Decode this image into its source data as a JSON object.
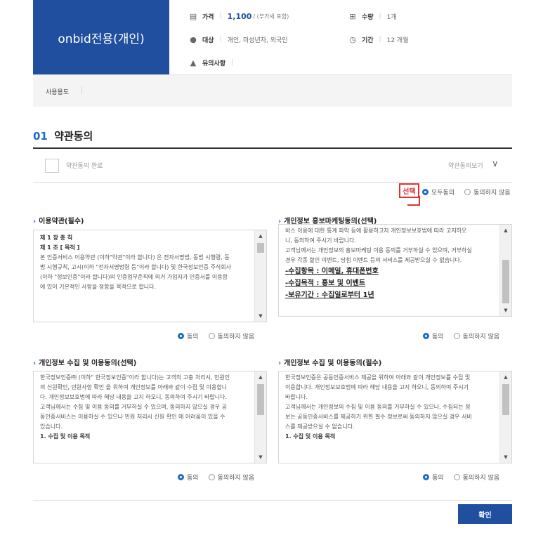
{
  "product": {
    "name": "onbid전용(개인)",
    "price_label": "가격",
    "price_value": "1,100",
    "price_unit": "/ (부가세 포함)",
    "quantity_label": "수량",
    "quantity_value": "1개",
    "target_label": "대상",
    "target_value": "개인, 미성년자, 외국인",
    "period_label": "기간",
    "period_value": "12 개월",
    "notice_label": "유의사항",
    "usage_label": "사용용도"
  },
  "section": {
    "number": "01",
    "title": "약관동의",
    "agree_done_label": "약관동의 완료",
    "view_terms_label": "약관동의보기"
  },
  "global_choice": {
    "stamp": "선택",
    "agree_all": "모두동의",
    "disagree_all": "동의하지 않음"
  },
  "terms": [
    {
      "title": "이용약관(필수)",
      "lines": [
        "",
        "제 1 장 총 칙",
        "",
        "제 1 조 [ 목적 ]",
        "",
        "본 인증서비스 이용약관 (이하\"약관\"이라 합니다) 은 전자서명법, 동법 시행령, 동",
        "법 시행규칙, 고시(이하 \"전자서명법령 등\"이라 합니다) 및 한국정보인증 주식회사",
        "(이하 \"정보인증\"이라 합니다)의 인증업무준칙에 의거 가입자가 인증서를 이용함",
        "에 있어 기본적인 사항을 정함을 목적으로 합니다."
      ],
      "agree": "동의",
      "disagree": "동의하지 않음"
    },
    {
      "title": "개인정보 홍보마케팅동의(선택)",
      "lines": [
        "비스 이용에 대한 통계 파악 등에 활용하고자 개인정보보호법에 따라 고지하오",
        "니, 동의하여 주시기 바랍니다.",
        "고객님께서는 개인정보의 홍보마케팅 이용 동의를 거부하실 수 있으며, 거부하실",
        "경우 각종 할인 이벤트, 당첨 이벤트 등의 서비스를 제공받으실 수 없습니다.",
        "",
        "-수집항목 : 이메일, 휴대폰번호",
        "-수집목적 : 홍보 및 이벤트",
        "-보유기간 : 수집일로부터 1년"
      ],
      "agree": "동의",
      "disagree": "동의하지 않음"
    },
    {
      "title": "개인정보 수집 및 이용동의(선택)",
      "lines": [
        "",
        "한국정보인증㈜ (이하\" 한국정보인증\"이라 합니다)는 고객의 고충 처리시, 민원인",
        "의 신원확인, 민원사항 확인 을 위하여 개인정보를 아래와 같이 수집 및 이용합니",
        "다. 개인정보보호법에 따라 해당 내용을 고지 하오니, 동의하여 주시기 바랍니다.",
        "고객님께서는 수집 및 이용 동의를 거부하실 수 있으며, 동의하지 않으실 경우 공",
        "동인증서비스는 이용하실 수 있으나 민원 처리시 신원 확인 에 어려움이 있을 수",
        "있습니다.",
        "",
        "1. 수집 및 이용 목적"
      ],
      "agree": "동의",
      "disagree": "동의하지 않음"
    },
    {
      "title": "개인정보 수집 및 이용동의(필수)",
      "lines": [
        "",
        "한국정보인증은 공동인증서비스 제공을 위하여 아래와 같이 개인정보를 수집 및",
        "이용합니다. 개인정보보호법에 따라 해당 내용을 고지 하오니, 동의하여 주시기",
        "바랍니다.",
        "고객님께서는 개인정보의 수집 및 이용 동의를 거부하실 수 있으나, 수집되는 정",
        "보는 공동인증서비스를 제공하기 위한 필수 정보로써 동의하지 않으실 경우 서비",
        "스를 제공받으실 수 없습니다.",
        "",
        "1. 수집 및 이용 목적"
      ],
      "agree": "동의",
      "disagree": "동의하지 않음"
    }
  ],
  "confirm_label": "확인",
  "colors": {
    "brand": "#1f4f9e",
    "accent": "#1f6cc6",
    "stamp": "#dd3333"
  }
}
